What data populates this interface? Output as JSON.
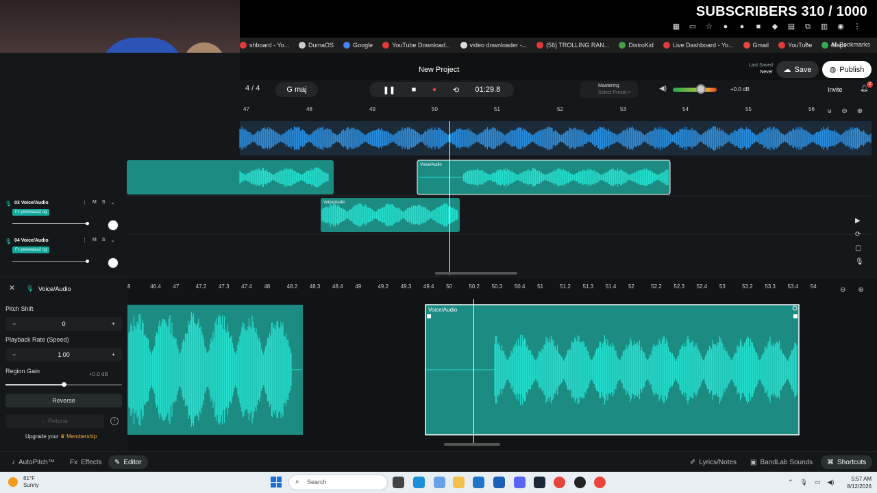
{
  "overlay": {
    "subscribers": "SUBSCRIBERS 310 / 1000"
  },
  "bookmarks": {
    "items": [
      {
        "label": "shboard - Yo...",
        "color": "#e23a3a"
      },
      {
        "label": "DumaOS",
        "color": "#cccccc"
      },
      {
        "label": "Google",
        "color": "#4285f4"
      },
      {
        "label": "YouTube Download...",
        "color": "#e23a3a"
      },
      {
        "label": "video downloader -...",
        "color": "#dddddd"
      },
      {
        "label": "(56) TROLLING RAN...",
        "color": "#e23a3a"
      },
      {
        "label": "DistroKid",
        "color": "#3fa144"
      },
      {
        "label": "Live Dashboard - Yo...",
        "color": "#e23a3a"
      },
      {
        "label": "Gmail",
        "color": "#e8453c"
      },
      {
        "label": "YouTube",
        "color": "#e23a3a"
      },
      {
        "label": "Maps",
        "color": "#34a853"
      }
    ],
    "more": "»",
    "all": "All Bookmarks"
  },
  "header": {
    "project_title": "New Project",
    "last_saved_label": "Last Saved",
    "last_saved_value": "Never",
    "save": "Save",
    "publish": "Publish"
  },
  "transport": {
    "time_signature": "4 / 4",
    "key": "G maj",
    "time": "01:29.8",
    "mastering": "Mastering",
    "mastering_preset": "Select Preset >",
    "volume_db": "+0.0 dB",
    "invite": "Invite",
    "notifications": "2"
  },
  "ruler_top": [
    "47",
    "48",
    "49",
    "50",
    "51",
    "52",
    "53",
    "54",
    "55",
    "56"
  ],
  "tracks": [
    {
      "number": "03",
      "name": "Voice/Audio",
      "fx": "Fx yeeeeaaa2 og",
      "mute": "M",
      "solo": "S"
    },
    {
      "number": "04",
      "name": "Voice/Audio",
      "fx": "Fx yeeeeaaa2 og",
      "mute": "M",
      "solo": "S"
    }
  ],
  "clips": {
    "label": "Voice/Audio"
  },
  "editor": {
    "region_title": "Voice/Audio",
    "pitch_shift_label": "Pitch Shift",
    "pitch_shift_value": "0",
    "playback_rate_label": "Playback Rate (Speed)",
    "playback_rate_value": "1.00",
    "region_gain_label": "Region Gain",
    "region_gain_value": "+0.0 dB",
    "reverse": "Reverse",
    "retune": "Retune",
    "upgrade_prefix": "Upgrade your",
    "upgrade_link": "Membership",
    "clip_label": "Voice/Audio",
    "ruler": [
      "8",
      "46.4",
      "47",
      "47.2",
      "47.3",
      "47.4",
      "48",
      "48.2",
      "48.3",
      "48.4",
      "49",
      "49.2",
      "49.3",
      "49.4",
      "50",
      "50.2",
      "50.3",
      "50.4",
      "51",
      "51.2",
      "51.3",
      "51.4",
      "52",
      "52.2",
      "52.3",
      "52.4",
      "53",
      "53.2",
      "53.3",
      "53.4",
      "54"
    ]
  },
  "bottom_tabs": {
    "autopitch": "AutoPitch™",
    "effects": "Effects",
    "editor": "Editor",
    "lyrics": "Lyrics/Notes",
    "bandlab_sounds": "BandLab Sounds",
    "shortcuts": "Shortcuts"
  },
  "taskbar": {
    "temperature": "81°F",
    "weather": "Sunny",
    "search": "Search",
    "time": "5:57 AM",
    "date": "8/12/2026"
  },
  "colors": {
    "teal_clip": "#1c8b82",
    "teal_wave": "#25e0cf",
    "blue_wave": "#2b8fe0",
    "accent_red": "#e53e3e"
  }
}
